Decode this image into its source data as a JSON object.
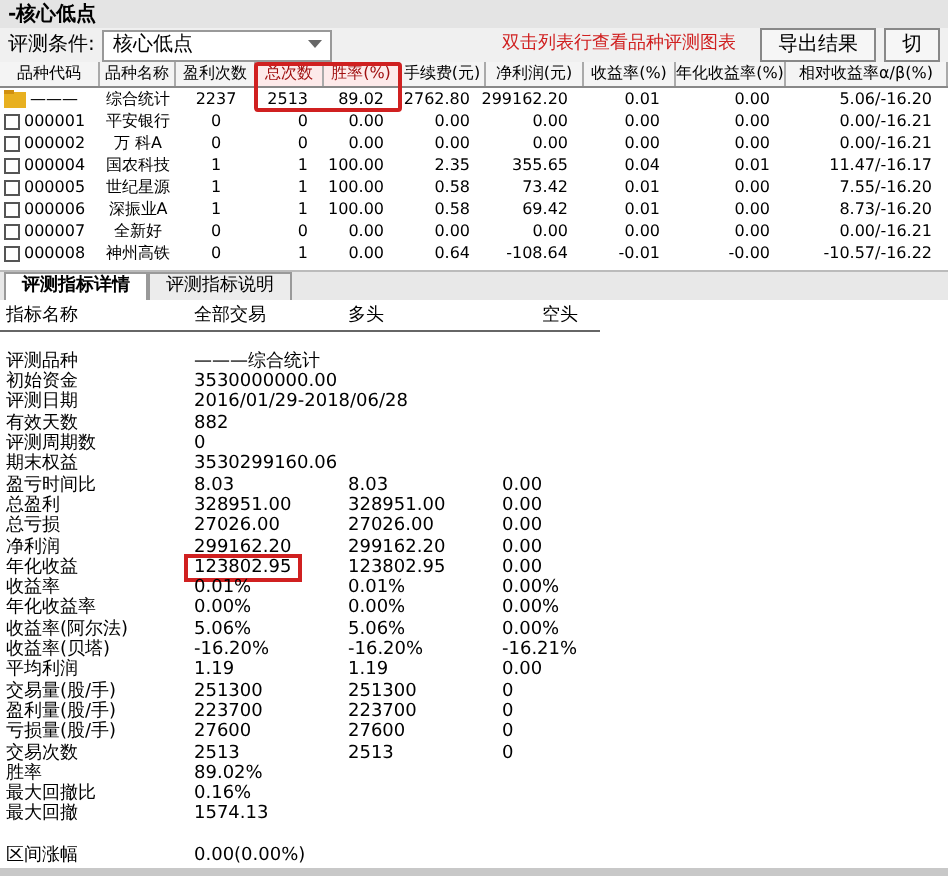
{
  "window": {
    "title": "-核心低点"
  },
  "condition": {
    "label": "评测条件:",
    "value": "核心低点",
    "hint": "双击列表行查看品种评测图表",
    "buttons": [
      "导出结果",
      "切"
    ]
  },
  "table": {
    "columns": [
      {
        "label": "品种代码",
        "highlighted": false
      },
      {
        "label": "品种名称",
        "highlighted": false
      },
      {
        "label": "盈利次数",
        "highlighted": false
      },
      {
        "label": "总次数",
        "highlighted": true
      },
      {
        "label": "胜率(%)",
        "highlighted": true
      },
      {
        "label": "手续费(元)",
        "highlighted": false
      },
      {
        "label": "净利润(元)",
        "highlighted": false
      },
      {
        "label": "收益率(%)",
        "highlighted": false
      },
      {
        "label": "年化收益率(%)",
        "highlighted": false
      },
      {
        "label": "相对收益率α/β(%)",
        "highlighted": false
      }
    ],
    "rows": [
      {
        "kind": "summary",
        "cells": [
          "———",
          "综合统计",
          "2237",
          "2513",
          "89.02",
          "2762.80",
          "299162.20",
          "0.01",
          "0.00",
          "5.06/-16.20"
        ]
      },
      {
        "kind": "stock",
        "checked": false,
        "cells": [
          "000001",
          "平安银行",
          "0",
          "0",
          "0.00",
          "0.00",
          "0.00",
          "0.00",
          "0.00",
          "0.00/-16.21"
        ]
      },
      {
        "kind": "stock",
        "checked": false,
        "cells": [
          "000002",
          "万 科A",
          "0",
          "0",
          "0.00",
          "0.00",
          "0.00",
          "0.00",
          "0.00",
          "0.00/-16.21"
        ]
      },
      {
        "kind": "stock",
        "checked": false,
        "cells": [
          "000004",
          "国农科技",
          "1",
          "1",
          "100.00",
          "2.35",
          "355.65",
          "0.04",
          "0.01",
          "11.47/-16.17"
        ]
      },
      {
        "kind": "stock",
        "checked": false,
        "cells": [
          "000005",
          "世纪星源",
          "1",
          "1",
          "100.00",
          "0.58",
          "73.42",
          "0.01",
          "0.00",
          "7.55/-16.20"
        ]
      },
      {
        "kind": "stock",
        "checked": false,
        "cells": [
          "000006",
          "深振业A",
          "1",
          "1",
          "100.00",
          "0.58",
          "69.42",
          "0.01",
          "0.00",
          "8.73/-16.20"
        ]
      },
      {
        "kind": "stock",
        "checked": false,
        "cells": [
          "000007",
          "全新好",
          "0",
          "0",
          "0.00",
          "0.00",
          "0.00",
          "0.00",
          "0.00",
          "0.00/-16.21"
        ]
      },
      {
        "kind": "stock",
        "checked": false,
        "cells": [
          "000008",
          "神州高铁",
          "0",
          "1",
          "0.00",
          "0.64",
          "-108.64",
          "-0.01",
          "-0.00",
          "-10.57/-16.22"
        ]
      }
    ]
  },
  "tabs": [
    {
      "label": "评测指标详情",
      "selected": true
    },
    {
      "label": "评测指标说明",
      "selected": false
    }
  ],
  "detail": {
    "columns": [
      "指标名称",
      "全部交易",
      "多头",
      "空头"
    ],
    "rows": [
      {
        "name": "评测品种",
        "all": "———综合统计",
        "highlighted": false
      },
      {
        "name": "初始资金",
        "all": "3530000000.00",
        "highlighted": false
      },
      {
        "name": "评测日期",
        "all": "2016/01/29-2018/06/28",
        "highlighted": false
      },
      {
        "name": "有效天数",
        "all": "882",
        "highlighted": false
      },
      {
        "name": "评测周期数",
        "all": "0",
        "highlighted": false
      },
      {
        "name": "期末权益",
        "all": "3530299160.06",
        "highlighted": false
      },
      {
        "name": "盈亏时间比",
        "all": "8.03",
        "long": "8.03",
        "short": "0.00",
        "highlighted": false
      },
      {
        "name": "总盈利",
        "all": "328951.00",
        "long": "328951.00",
        "short": "0.00",
        "highlighted": false
      },
      {
        "name": "总亏损",
        "all": "27026.00",
        "long": "27026.00",
        "short": "0.00",
        "highlighted": false
      },
      {
        "name": "净利润",
        "all": "299162.20",
        "long": "299162.20",
        "short": "0.00",
        "highlighted": false
      },
      {
        "name": "年化收益",
        "all": "123802.95",
        "long": "123802.95",
        "short": "0.00",
        "highlighted": true
      },
      {
        "name": "收益率",
        "all": "0.01%",
        "long": "0.01%",
        "short": "0.00%",
        "highlighted": false
      },
      {
        "name": "年化收益率",
        "all": "0.00%",
        "long": "0.00%",
        "short": "0.00%",
        "highlighted": false
      },
      {
        "name": "收益率(阿尔法)",
        "all": "5.06%",
        "long": "5.06%",
        "short": "0.00%",
        "highlighted": false
      },
      {
        "name": "收益率(贝塔)",
        "all": "-16.20%",
        "long": "-16.20%",
        "short": "-16.21%",
        "highlighted": false
      },
      {
        "name": "平均利润",
        "all": "1.19",
        "long": "1.19",
        "short": "0.00",
        "highlighted": false
      },
      {
        "name": "交易量(股/手)",
        "all": "251300",
        "long": "251300",
        "short": "0",
        "highlighted": false
      },
      {
        "name": "盈利量(股/手)",
        "all": "223700",
        "long": "223700",
        "short": "0",
        "highlighted": false
      },
      {
        "name": "亏损量(股/手)",
        "all": "27600",
        "long": "27600",
        "short": "0",
        "highlighted": false
      },
      {
        "name": "交易次数",
        "all": "2513",
        "long": "2513",
        "short": "0",
        "highlighted": false
      },
      {
        "name": "胜率",
        "all": "89.02%",
        "highlighted": false
      },
      {
        "name": "最大回撤比",
        "all": "0.16%",
        "highlighted": false
      },
      {
        "name": "最大回撤",
        "all": "1574.13",
        "highlighted": false
      },
      {
        "name": "区间涨幅",
        "all": "0.00(0.00%)",
        "highlighted": false,
        "gap": true
      }
    ]
  }
}
